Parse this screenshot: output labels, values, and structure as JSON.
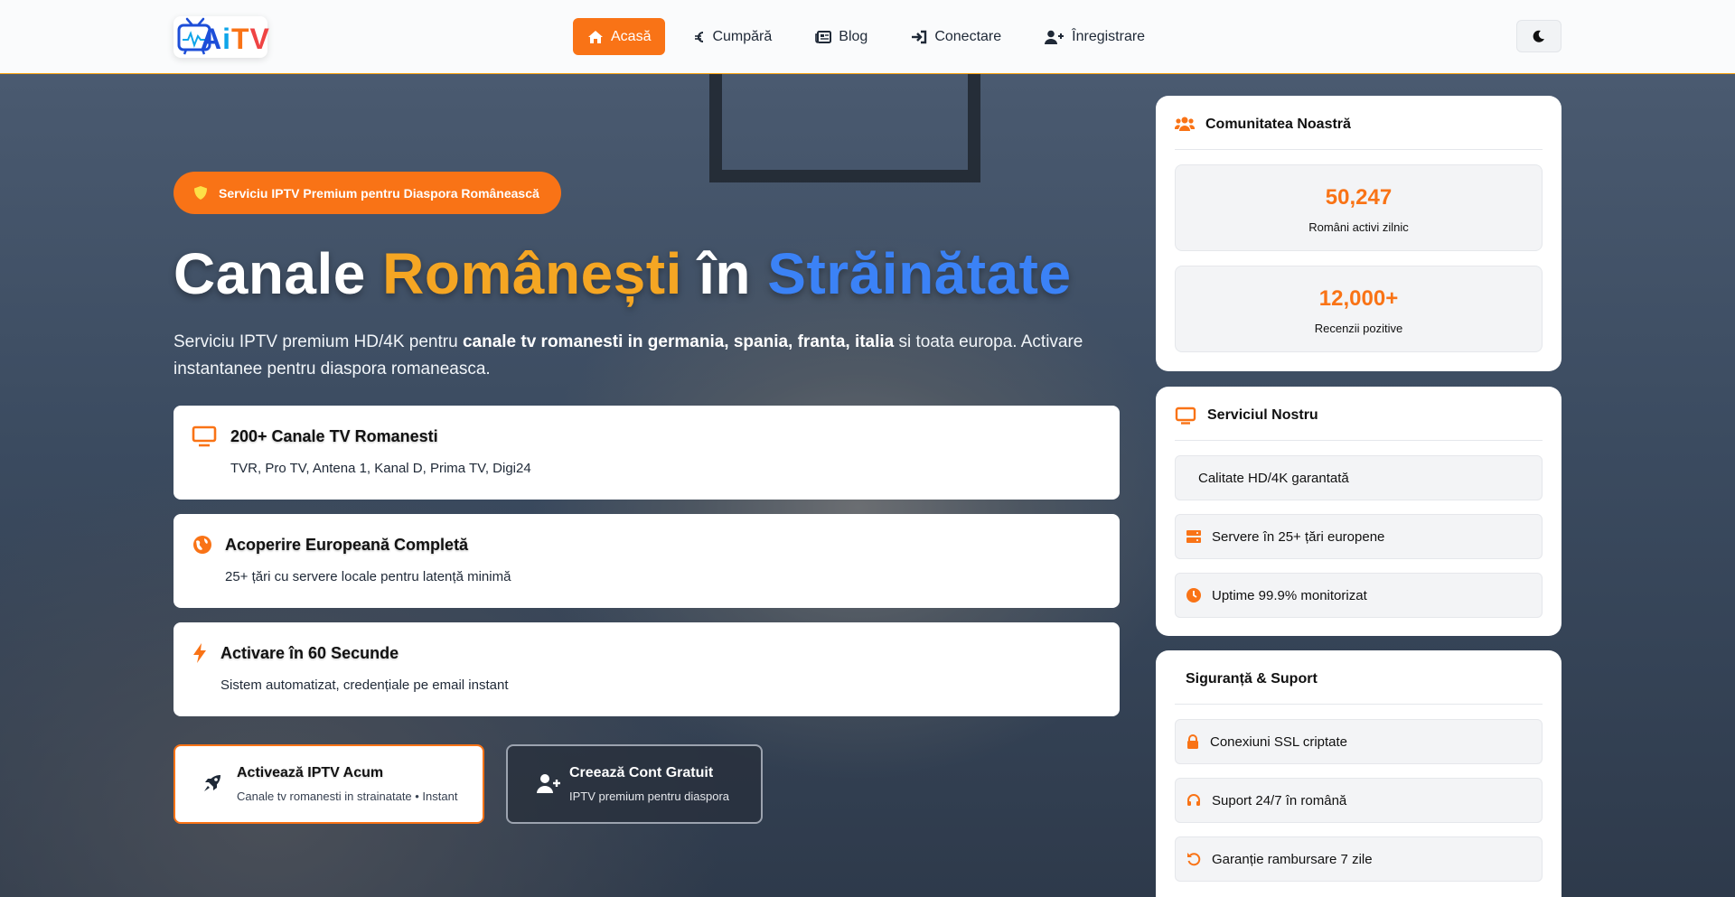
{
  "header": {
    "logo_text": {
      "a": "A",
      "i": "i",
      "t": "T",
      "v": "V"
    },
    "nav": [
      {
        "label": "Acasă",
        "icon": "home-icon",
        "active": true
      },
      {
        "label": "Cumpără",
        "icon": "euro-icon"
      },
      {
        "label": "Blog",
        "icon": "newspaper-icon"
      },
      {
        "label": "Conectare",
        "icon": "sign-in-icon"
      },
      {
        "label": "Înregistrare",
        "icon": "user-plus-icon"
      }
    ],
    "theme_toggle_icon": "moon-icon"
  },
  "hero": {
    "badge": "Serviciu IPTV Premium pentru Diaspora Românească",
    "title": {
      "part1": "Canale",
      "part2": "Românești",
      "part3": "în",
      "part4": "Străinătate"
    },
    "description": {
      "before": "Serviciu IPTV premium HD/4K pentru ",
      "bold": "canale tv romanesti in germania, spania, franta, italia",
      "after": " si toata europa. Activare instantanee pentru diaspora romaneasca."
    },
    "features": [
      {
        "icon": "tv-icon",
        "title": "200+ Canale TV Romanesti",
        "desc": "TVR, Pro TV, Antena 1, Kanal D, Prima TV, Digi24"
      },
      {
        "icon": "globe-europe-icon",
        "title": "Acoperire Europeană Completă",
        "desc": "25+ țări cu servere locale pentru latență minimă"
      },
      {
        "icon": "bolt-icon",
        "title": "Activare în 60 Secunde",
        "desc": "Sistem automatizat, credențiale pe email instant"
      }
    ],
    "cta_primary": {
      "title": "Activează IPTV Acum",
      "sub": "Canale tv romanesti in strainatate • Instant",
      "icon": "rocket-icon"
    },
    "cta_secondary": {
      "title": "Creează Cont Gratuit",
      "sub": "IPTV premium pentru diaspora",
      "icon": "user-plus-icon"
    }
  },
  "sidebar": {
    "community": {
      "title": "Comunitatea Noastră",
      "icon": "users-icon",
      "stats": [
        {
          "value": "50,247",
          "label": "Români activi zilnic"
        },
        {
          "value": "12,000+",
          "label": "Recenzii pozitive"
        }
      ]
    },
    "service": {
      "title": "Serviciul Nostru",
      "icon": "tv-icon",
      "items": [
        {
          "label": "Calitate HD/4K garantată",
          "icon": ""
        },
        {
          "label": "Servere în 25+ țări europene",
          "icon": "server-icon"
        },
        {
          "label": "Uptime 99.9% monitorizat",
          "icon": "clock-icon"
        }
      ]
    },
    "security": {
      "title": "Siguranță & Suport",
      "items": [
        {
          "label": "Conexiuni SSL criptate",
          "icon": "lock-icon"
        },
        {
          "label": "Suport 24/7 în română",
          "icon": "headset-icon"
        },
        {
          "label": "Garanție rambursare 7 zile",
          "icon": "undo-icon"
        }
      ]
    }
  },
  "colors": {
    "accent": "#f97316",
    "title_orange": "#f5a623",
    "title_blue": "#3b82f6"
  }
}
